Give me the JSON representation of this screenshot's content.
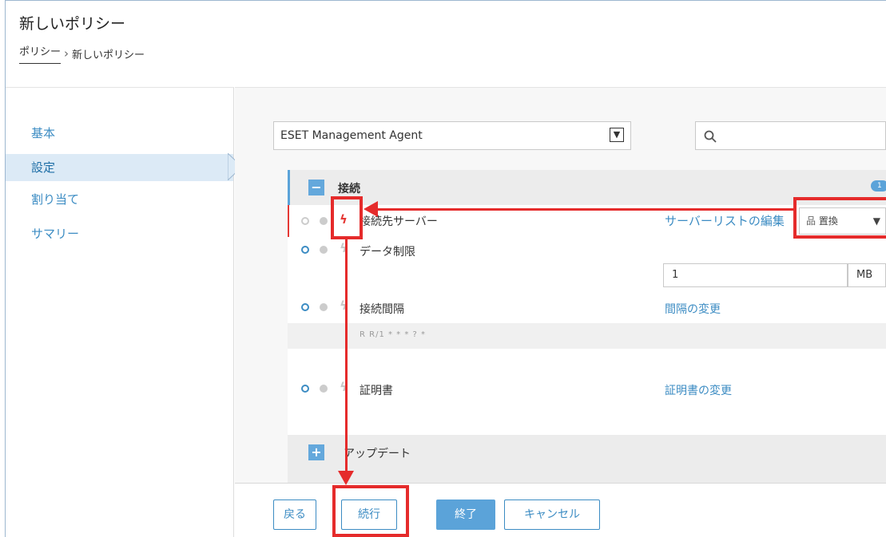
{
  "header": {
    "title": "新しいポリシー",
    "breadcrumb": [
      "ポリシー",
      "新しいポリシー"
    ]
  },
  "sidebar": {
    "items": [
      {
        "label": "基本",
        "active": false
      },
      {
        "label": "設定",
        "active": true
      },
      {
        "label": "割り当て",
        "active": false
      },
      {
        "label": "サマリー",
        "active": false
      }
    ]
  },
  "product_select": {
    "value": "ESET Management Agent"
  },
  "search": {
    "placeholder": ""
  },
  "sections": [
    {
      "label": "接続",
      "expanded": true,
      "badge": "1"
    },
    {
      "label": "アップデート",
      "expanded": false
    }
  ],
  "settings": {
    "server": {
      "label": "接続先サーバー",
      "link": "サーバーリストの編集",
      "mode": "置換"
    },
    "data_limit": {
      "label": "データ制限",
      "value": "1",
      "unit": "MB"
    },
    "interval": {
      "label": "接続間隔",
      "link": "間隔の変更",
      "detail": "R R/1 * * * ? *"
    },
    "cert": {
      "label": "証明書",
      "link": "証明書の変更"
    }
  },
  "footer": {
    "back": "戻る",
    "continue": "続行",
    "finish": "終了",
    "cancel": "キャンセル"
  },
  "colors": {
    "accent": "#3c8cc3",
    "annotation": "#e52b2b"
  }
}
